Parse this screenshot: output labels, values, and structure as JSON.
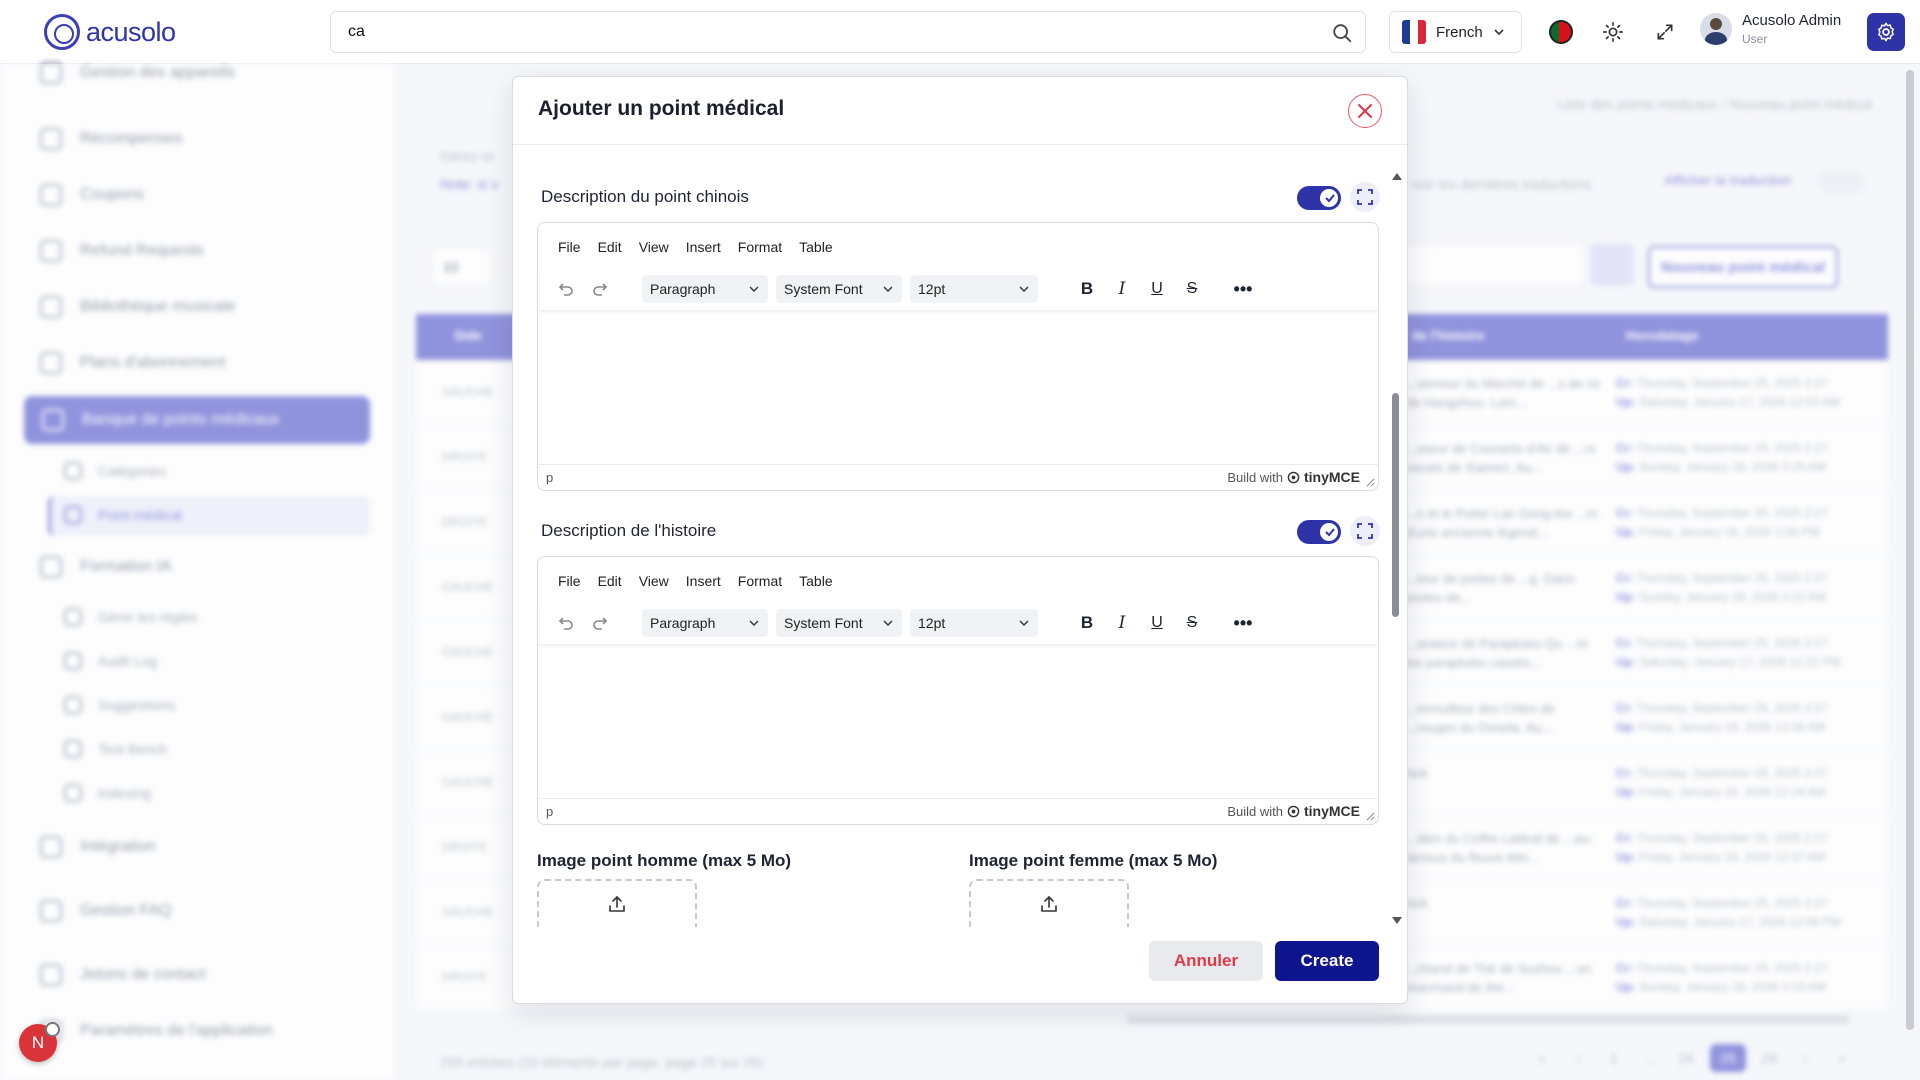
{
  "header": {
    "logo_text": "acusolo",
    "search_value": "ca",
    "language": "French",
    "user_name": "Acusolo Admin",
    "user_role": "User"
  },
  "sidebar": {
    "items": [
      {
        "label": "Gestion des appareils",
        "icon": "device-icon"
      },
      {
        "label": "Récompenses",
        "icon": "trophy-icon"
      },
      {
        "label": "Coupons",
        "icon": "ticket-icon"
      },
      {
        "label": "Refund Requests",
        "icon": "refund-icon"
      },
      {
        "label": "Bibliothèque musicale",
        "icon": "music-icon"
      },
      {
        "label": "Plans d'abonnement",
        "icon": "card-icon"
      },
      {
        "label": "Banque de points médicaux",
        "icon": "medical-icon",
        "active": true
      },
      {
        "label": "Formation IA",
        "icon": "ai-icon"
      },
      {
        "label": "Intégration",
        "icon": "integration-icon"
      },
      {
        "label": "Gestion FAQ",
        "icon": "faq-icon"
      },
      {
        "label": "Jetons de contact",
        "icon": "phone-icon"
      },
      {
        "label": "Paramètres de l'application",
        "icon": "settings-icon"
      }
    ],
    "subitems": [
      {
        "label": "Catégories"
      },
      {
        "label": "Point médical",
        "active": true
      },
      {
        "label": "Gérer les règles"
      },
      {
        "label": "Audit Log"
      },
      {
        "label": "Suggestions"
      },
      {
        "label": "Test Bench"
      },
      {
        "label": "Indexing"
      }
    ]
  },
  "background": {
    "breadcrumb_1": "Liste des points médicaux",
    "breadcrumb_2": "Nouveau point médical",
    "manage_text": "Gérez et",
    "note_text": "Note: si v",
    "translations_text": "voir les dernières traductions",
    "show_translation": "Afficher la traduction",
    "per_page": "10",
    "new_button": "Nouveau point médical",
    "col_side": "Side",
    "col_story": "de l'histoire",
    "col_timestamp": "Horodatage",
    "rows": [
      {
        "side": "GAUCHE",
        "story": "...verneur du Marché de ...s de riz de Hangzhou. Lors...",
        "cr": "Thursday, September 25, 2025 2:27",
        "up": "Saturday, January 17, 2026 12:53 AM"
      },
      {
        "side": "DROITE",
        "story": "...sseur de Courants d'Air de ...rs navals de Xiamen. Au...",
        "cr": "Thursday, September 25, 2025 2:27",
        "up": "Sunday, January 18, 2026 3:25 AM"
      },
      {
        "side": "DROITE",
        "story": "...n et le Potier Lao Gong tire ...m d'une ancienne légend...",
        "cr": "Thursday, September 25, 2025 2:27",
        "up": "Friday, January 16, 2026 1:06 PM"
      },
      {
        "side": "GAUCHE",
        "story": "...teur de portes de ...g. Dans portes de...",
        "cr": "Thursday, September 25, 2025 2:27",
        "up": "Sunday, January 18, 2026 3:22 AM"
      },
      {
        "side": "GAUCHE",
        "story": "...arateur de Parapluies Qu ...re les parapluies cassés...",
        "cr": "Thursday, September 25, 2025 2:27",
        "up": "Saturday, January 17, 2026 12:22 PM"
      },
      {
        "side": "GAUCHE",
        "story": "...errouilleur des Côtes de ...rouges du Donela. Au...",
        "cr": "Thursday, September 25, 2025 2:27",
        "up": "Friday, January 16, 2026 12:06 AM"
      },
      {
        "side": "GAUCHE",
        "story": "N/A",
        "cr": "Thursday, September 25, 2025 2:27",
        "up": "Friday, January 16, 2026 12:24 AM"
      },
      {
        "side": "DROITE",
        "story": "...dien du Coffre Latéral de ...au-dessus du fleuve Min...",
        "cr": "Thursday, September 25, 2025 2:27",
        "up": "Friday, January 16, 2026 12:37 AM"
      },
      {
        "side": "GAUCHE",
        "story": "N/A",
        "cr": "Thursday, September 25, 2025 2:27",
        "up": "Saturday, January 17, 2026 12:09 PM"
      },
      {
        "side": "DROITE",
        "story": "...chand de Thé de Suzhou ...un marchand de thé...",
        "cr": "Thursday, September 25, 2025 2:27",
        "up": "Sunday, January 18, 2026 3:19 AM"
      }
    ],
    "cr_label": "Cr:",
    "up_label": "Up:",
    "entries": "255 entrées (10 éléments par page, page 25 sur 26)",
    "pages": [
      "«",
      "‹",
      "1",
      "...",
      "24",
      "25",
      "26",
      "›",
      "»"
    ]
  },
  "modal": {
    "title": "Ajouter un point médical",
    "section1_label": "Description du point chinois",
    "section2_label": "Description de l'histoire",
    "menu": [
      "File",
      "Edit",
      "View",
      "Insert",
      "Format",
      "Table"
    ],
    "block_format": "Paragraph",
    "font_family": "System Font",
    "font_size": "12pt",
    "status_path": "p",
    "build_with": "Build with",
    "brand": "tinyMCE",
    "image_male_label": "Image point homme (max 5 Mo)",
    "image_female_label": "Image point femme (max 5 Mo)",
    "cancel_label": "Annuler",
    "create_label": "Create"
  },
  "notification": {
    "initial": "N"
  },
  "colors": {
    "primary": "#2f33a8",
    "create": "#0f158f",
    "danger": "#e0394a"
  }
}
